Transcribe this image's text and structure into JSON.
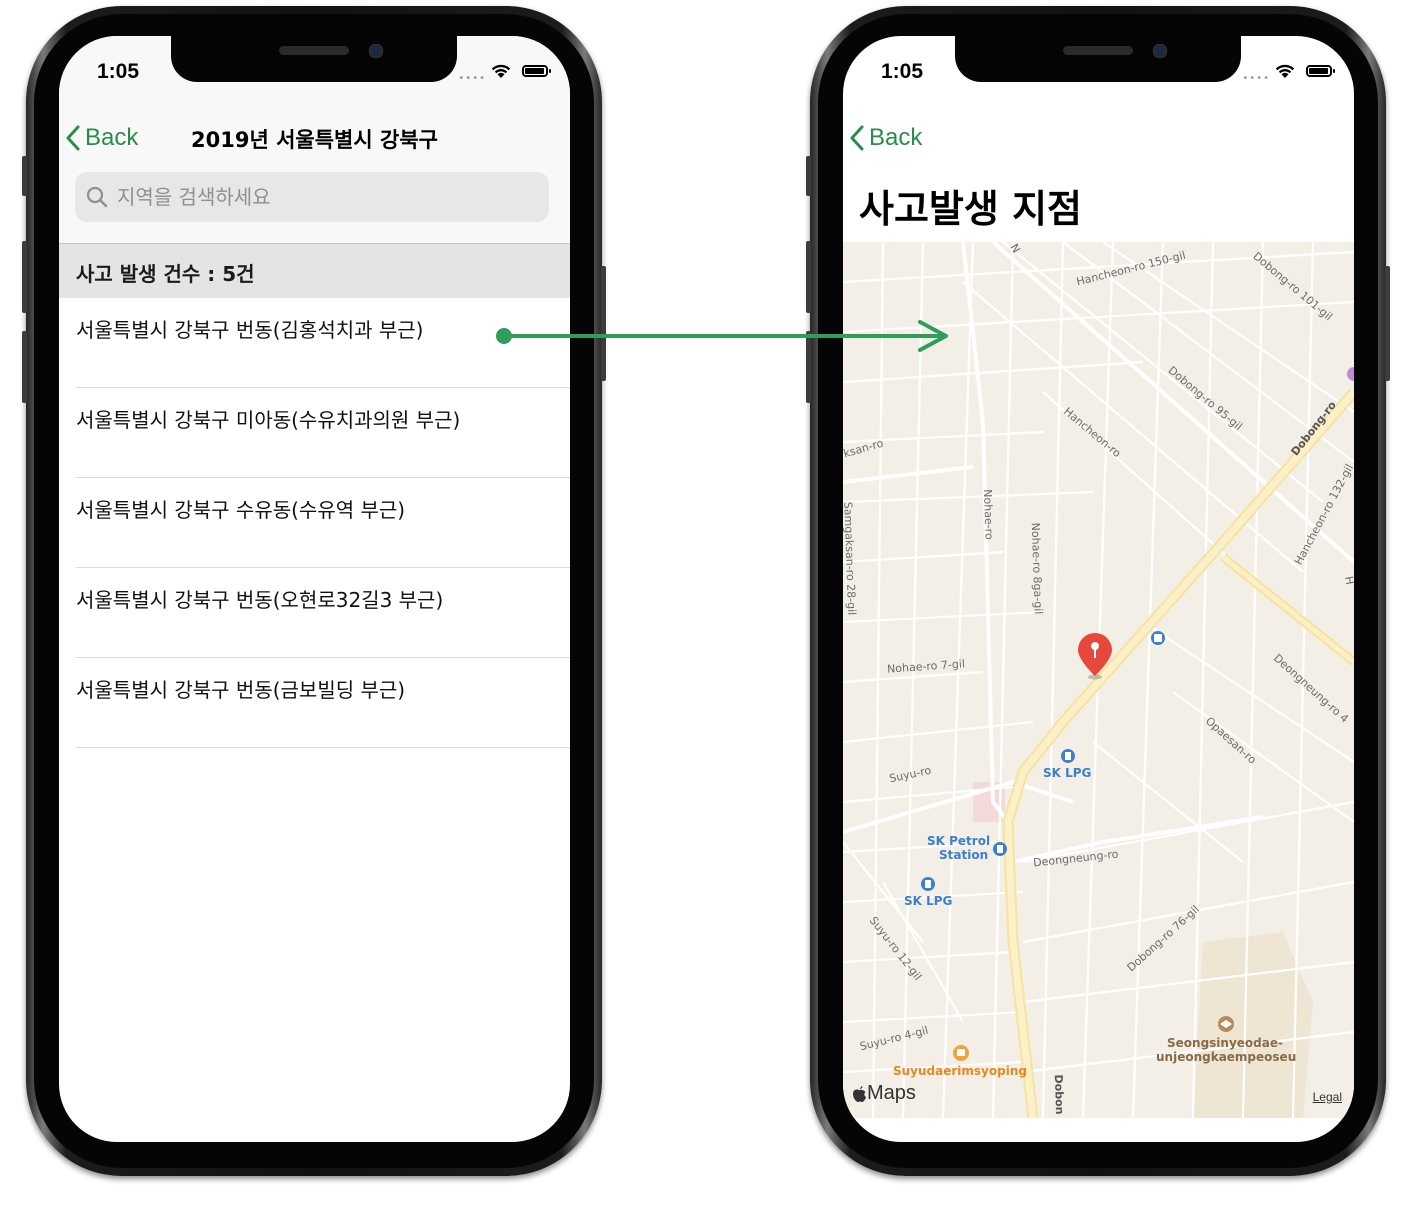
{
  "status_bar": {
    "time": "1:05"
  },
  "list_screen": {
    "back_label": "Back",
    "title": "2019년 서울특별시 강북구",
    "search_placeholder": "지역을 검색하세요",
    "section_header": "사고 발생 건수 : 5건",
    "items": [
      "서울특별시 강북구 번동(김홍석치과 부근)",
      "서울특별시 강북구 미아동(수유치과의원 부근)",
      "서울특별시 강북구 수유동(수유역 부근)",
      "서울특별시 강북구 번동(오현로32길3 부근)",
      "서울특별시 강북구 번동(금보빌딩 부근)"
    ]
  },
  "map_screen": {
    "back_label": "Back",
    "title": "사고발생 지점",
    "map_labels": {
      "hancheon_150": "Hancheon-ro 150-gil",
      "dobong_101": "Dobong-ro 101-gil",
      "dobong_95": "Dobong-ro 95-gil",
      "hancheon_ro": "Hancheon-ro",
      "dobong_ro": "Dobong-ro",
      "hancheon_132": "Hancheon-ro 132-gil",
      "samgaksan": "ksan-ro",
      "samgaksan_28": "Samgaksan-ro 28-gil",
      "nohae_ro": "Nohae-ro",
      "nohae_8ga": "Nohae-ro 8ga-gil",
      "nohae_7": "Nohae-ro 7-gil",
      "deongneung_upper": "Deongneung-ro 4",
      "opaesan": "Opaesan-ro",
      "suyu_ro": "Suyu-ro",
      "deongneung": "Deongneung-ro",
      "suyu_12": "Suyu-ro 12-gil",
      "dobong_76": "Dobong-ro 76-gil",
      "suyu_4": "Suyu-ro 4-gil",
      "dobon": "Dobon",
      "n_label": "N",
      "h_label": "H"
    },
    "pois": {
      "sk_lpg_1": "SK LPG",
      "sk_petrol_line1": "SK Petrol",
      "sk_petrol_line2": "Station",
      "sk_lpg_2": "SK LPG",
      "suyudaerim": "Suyudaerimsyoping",
      "seongsin_line1": "Seongsinyeodae-",
      "seongsin_line2": "unjeongkaempeoseu"
    },
    "maps_brand": "Maps",
    "legal": "Legal"
  },
  "colors": {
    "accent": "#2a8c4a",
    "arrow": "#2e9e5b",
    "pin": "#e8473c"
  }
}
